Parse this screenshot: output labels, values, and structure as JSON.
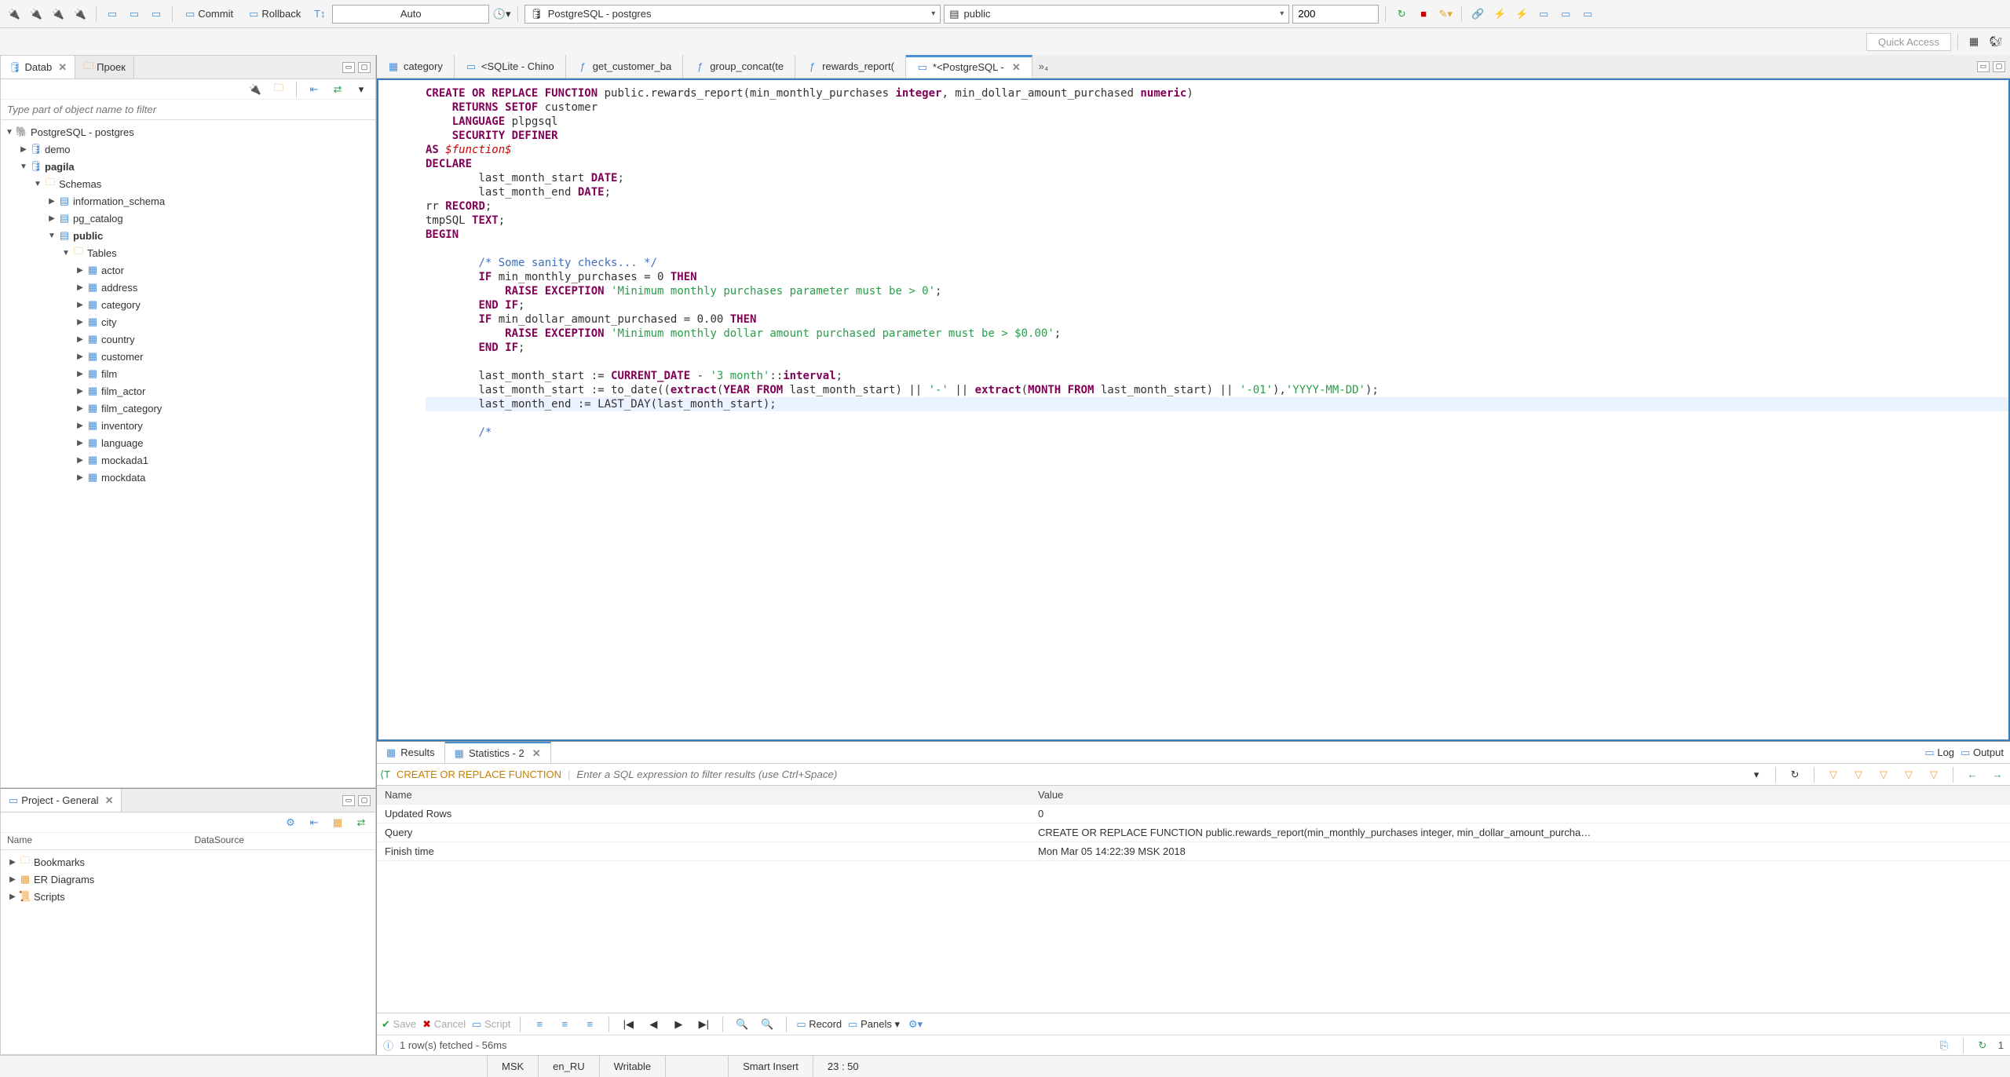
{
  "toolbar": {
    "commit_label": "Commit",
    "rollback_label": "Rollback",
    "tx_mode": "Auto",
    "datasource": "PostgreSQL - postgres",
    "schema": "public",
    "limit": "200",
    "quick_access": "Quick Access"
  },
  "db_panel": {
    "tab1": "Datab",
    "tab2": "Проек",
    "filter_placeholder": "Type part of object name to filter",
    "tree": {
      "root": "PostgreSQL - postgres",
      "db1": "demo",
      "db2": "pagila",
      "schemas": "Schemas",
      "s1": "information_schema",
      "s2": "pg_catalog",
      "s3": "public",
      "tables": "Tables",
      "t": [
        "actor",
        "address",
        "category",
        "city",
        "country",
        "customer",
        "film",
        "film_actor",
        "film_category",
        "inventory",
        "language",
        "mockada1",
        "mockdata"
      ]
    }
  },
  "project_panel": {
    "title": "Project - General",
    "col1": "Name",
    "col2": "DataSource",
    "items": [
      "Bookmarks",
      "ER Diagrams",
      "Scripts"
    ]
  },
  "editor_tabs": {
    "t1": "category",
    "t2": "<SQLite - Chino",
    "t3": "get_customer_ba",
    "t4": "group_concat(te",
    "t5": "rewards_report(",
    "t6": "*<PostgreSQL -",
    "overflow": "»₄"
  },
  "editor": {
    "code_lines": [
      {
        "indent": 0,
        "t": [
          {
            "c": "kw",
            "s": "CREATE OR REPLACE FUNCTION"
          },
          {
            "c": "",
            "s": " public.rewards_report(min_monthly_purchases "
          },
          {
            "c": "kw",
            "s": "integer"
          },
          {
            "c": "",
            "s": ", min_dollar_amount_purchased "
          },
          {
            "c": "kw",
            "s": "numeric"
          },
          {
            "c": "",
            "s": ")"
          }
        ]
      },
      {
        "indent": 1,
        "t": [
          {
            "c": "kw",
            "s": "RETURNS SETOF"
          },
          {
            "c": "",
            "s": " customer"
          }
        ]
      },
      {
        "indent": 1,
        "t": [
          {
            "c": "kw",
            "s": "LANGUAGE"
          },
          {
            "c": "",
            "s": " plpgsql"
          }
        ]
      },
      {
        "indent": 1,
        "t": [
          {
            "c": "kw",
            "s": "SECURITY DEFINER"
          }
        ]
      },
      {
        "indent": 0,
        "t": [
          {
            "c": "kw",
            "s": "AS"
          },
          {
            "c": "",
            "s": " "
          },
          {
            "c": "func",
            "s": "$function$"
          }
        ]
      },
      {
        "indent": 0,
        "t": [
          {
            "c": "kw",
            "s": "DECLARE"
          }
        ]
      },
      {
        "indent": 2,
        "t": [
          {
            "c": "",
            "s": "last_month_start "
          },
          {
            "c": "kw",
            "s": "DATE"
          },
          {
            "c": "",
            "s": ";"
          }
        ]
      },
      {
        "indent": 2,
        "t": [
          {
            "c": "",
            "s": "last_month_end "
          },
          {
            "c": "kw",
            "s": "DATE"
          },
          {
            "c": "",
            "s": ";"
          }
        ]
      },
      {
        "indent": 0,
        "t": [
          {
            "c": "",
            "s": "rr "
          },
          {
            "c": "kw",
            "s": "RECORD"
          },
          {
            "c": "",
            "s": ";"
          }
        ]
      },
      {
        "indent": 0,
        "t": [
          {
            "c": "",
            "s": "tmpSQL "
          },
          {
            "c": "kw",
            "s": "TEXT"
          },
          {
            "c": "",
            "s": ";"
          }
        ]
      },
      {
        "indent": 0,
        "t": [
          {
            "c": "kw",
            "s": "BEGIN"
          }
        ]
      },
      {
        "indent": 0,
        "t": [
          {
            "c": "",
            "s": ""
          }
        ]
      },
      {
        "indent": 2,
        "t": [
          {
            "c": "cmt",
            "s": "/* Some sanity checks... */"
          }
        ]
      },
      {
        "indent": 2,
        "t": [
          {
            "c": "kw",
            "s": "IF"
          },
          {
            "c": "",
            "s": " min_monthly_purchases = 0 "
          },
          {
            "c": "kw",
            "s": "THEN"
          }
        ]
      },
      {
        "indent": 3,
        "t": [
          {
            "c": "kw",
            "s": "RAISE EXCEPTION"
          },
          {
            "c": "",
            "s": " "
          },
          {
            "c": "str",
            "s": "'Minimum monthly purchases parameter must be > 0'"
          },
          {
            "c": "",
            "s": ";"
          }
        ]
      },
      {
        "indent": 2,
        "t": [
          {
            "c": "kw",
            "s": "END IF"
          },
          {
            "c": "",
            "s": ";"
          }
        ]
      },
      {
        "indent": 2,
        "t": [
          {
            "c": "kw",
            "s": "IF"
          },
          {
            "c": "",
            "s": " min_dollar_amount_purchased = 0.00 "
          },
          {
            "c": "kw",
            "s": "THEN"
          }
        ]
      },
      {
        "indent": 3,
        "t": [
          {
            "c": "kw",
            "s": "RAISE EXCEPTION"
          },
          {
            "c": "",
            "s": " "
          },
          {
            "c": "str",
            "s": "'Minimum monthly dollar amount purchased parameter must be > $0.00'"
          },
          {
            "c": "",
            "s": ";"
          }
        ]
      },
      {
        "indent": 2,
        "t": [
          {
            "c": "kw",
            "s": "END IF"
          },
          {
            "c": "",
            "s": ";"
          }
        ]
      },
      {
        "indent": 0,
        "t": [
          {
            "c": "",
            "s": ""
          }
        ]
      },
      {
        "indent": 2,
        "t": [
          {
            "c": "",
            "s": "last_month_start := "
          },
          {
            "c": "kw",
            "s": "CURRENT_DATE"
          },
          {
            "c": "",
            "s": " - "
          },
          {
            "c": "str",
            "s": "'3 month'"
          },
          {
            "c": "",
            "s": "::"
          },
          {
            "c": "kw",
            "s": "interval"
          },
          {
            "c": "",
            "s": ";"
          }
        ]
      },
      {
        "indent": 2,
        "t": [
          {
            "c": "",
            "s": "last_month_start := to_date(("
          },
          {
            "c": "kw",
            "s": "extract"
          },
          {
            "c": "",
            "s": "("
          },
          {
            "c": "kw",
            "s": "YEAR FROM"
          },
          {
            "c": "",
            "s": " last_month_start) || "
          },
          {
            "c": "str",
            "s": "'-'"
          },
          {
            "c": "",
            "s": " || "
          },
          {
            "c": "kw",
            "s": "extract"
          },
          {
            "c": "",
            "s": "("
          },
          {
            "c": "kw",
            "s": "MONTH FROM"
          },
          {
            "c": "",
            "s": " last_month_start) || "
          },
          {
            "c": "str",
            "s": "'-01'"
          },
          {
            "c": "",
            "s": "),"
          },
          {
            "c": "str",
            "s": "'YYYY-MM-DD'"
          },
          {
            "c": "",
            "s": ");"
          }
        ]
      },
      {
        "indent": 2,
        "hl": true,
        "t": [
          {
            "c": "",
            "s": "last_month_end := LAST_DAY(last_month_start);"
          }
        ]
      },
      {
        "indent": 0,
        "t": [
          {
            "c": "",
            "s": ""
          }
        ]
      },
      {
        "indent": 2,
        "t": [
          {
            "c": "cmt",
            "s": "/*"
          }
        ]
      }
    ]
  },
  "results": {
    "tab_results": "Results",
    "tab_stats": "Statistics - 2",
    "filter_label": "CREATE OR REPLACE FUNCTION",
    "filter_placeholder": "Enter a SQL expression to filter results (use Ctrl+Space)",
    "log_label": "Log",
    "output_label": "Output",
    "columns": [
      "Name",
      "Value"
    ],
    "rows": [
      {
        "name": "Updated Rows",
        "value": "0"
      },
      {
        "name": "Query",
        "value": "CREATE OR REPLACE FUNCTION public.rewards_report(min_monthly_purchases integer, min_dollar_amount_purcha…"
      },
      {
        "name": "Finish time",
        "value": "Mon Mar 05 14:22:39 MSK 2018"
      }
    ],
    "toolbar": {
      "save": "Save",
      "cancel": "Cancel",
      "script": "Script",
      "record": "Record",
      "panels": "Panels"
    },
    "status": "1 row(s) fetched - 56ms",
    "page": "1"
  },
  "status_bar": {
    "tz": "MSK",
    "locale": "en_RU",
    "mode": "Writable",
    "insert": "Smart Insert",
    "pos": "23 : 50"
  }
}
